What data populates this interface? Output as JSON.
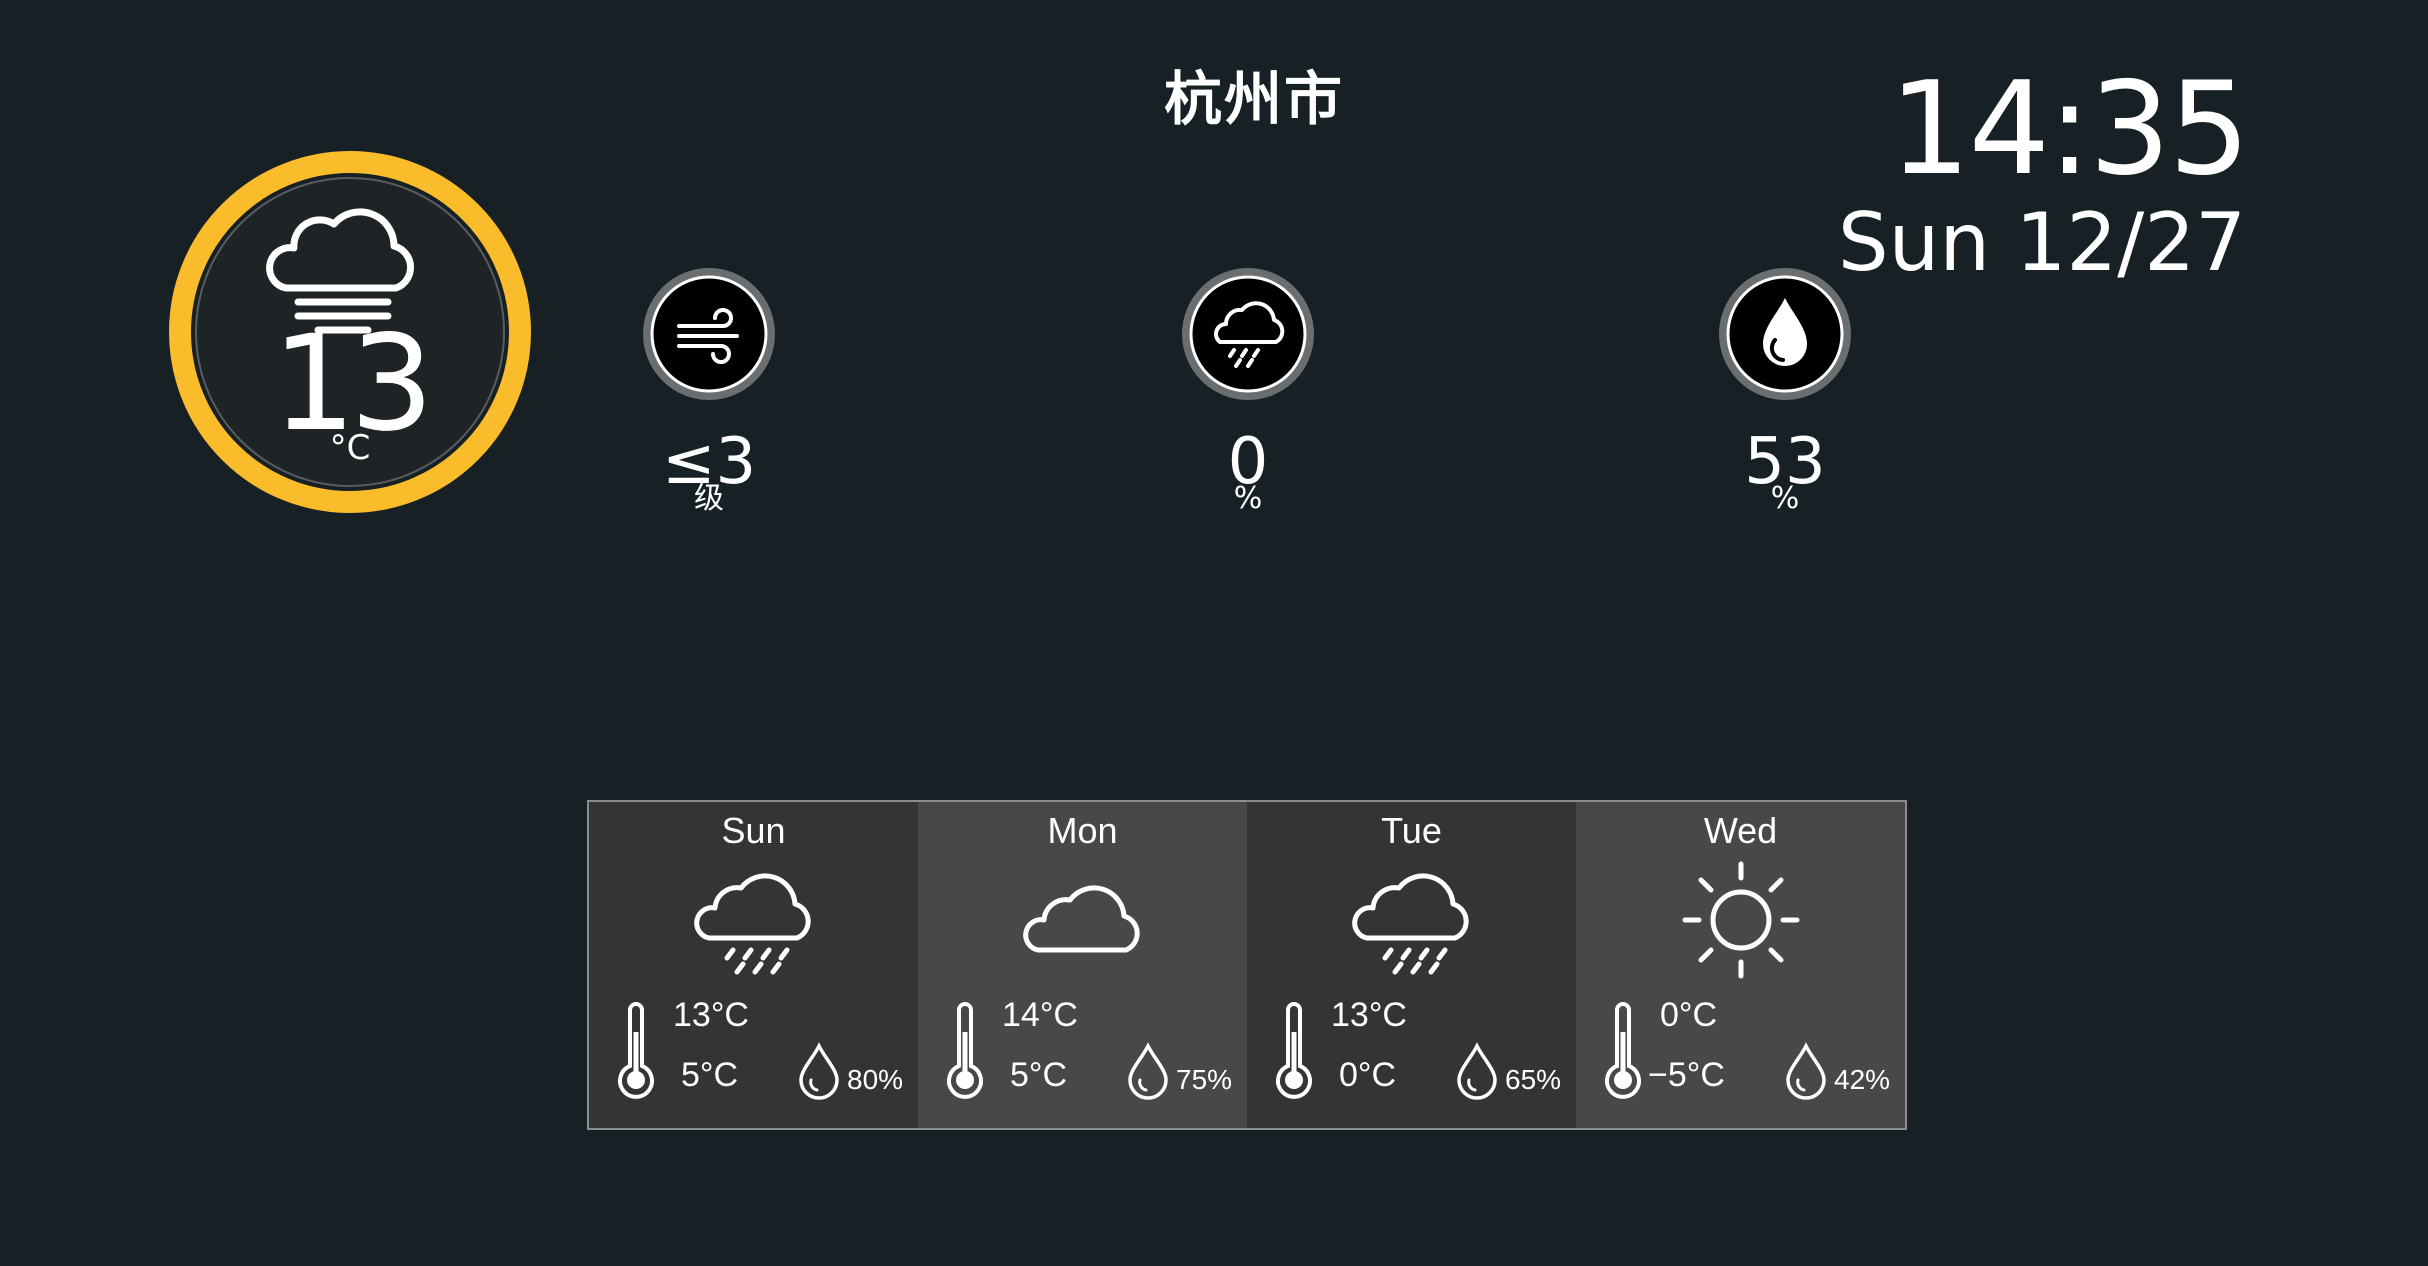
{
  "header": {
    "city": "杭州市",
    "time": "14:35",
    "date": "Sun 12/27"
  },
  "current": {
    "temperature": "13",
    "unit": "°C",
    "condition_icon": "cloud-fog-icon",
    "ring_color": "#fbbc2c"
  },
  "metrics": [
    {
      "icon": "wind-icon",
      "value": "≤3",
      "unit": "级"
    },
    {
      "icon": "cloud-rain-icon",
      "value": "0",
      "unit": "%"
    },
    {
      "icon": "humidity-drop-icon",
      "value": "53",
      "unit": "%"
    }
  ],
  "forecast": [
    {
      "day": "Sun",
      "icon": "cloud-rain-icon",
      "high": "13°C",
      "low": "5°C",
      "humidity": "80%"
    },
    {
      "day": "Mon",
      "icon": "cloud-icon",
      "high": "14°C",
      "low": "5°C",
      "humidity": "75%"
    },
    {
      "day": "Tue",
      "icon": "cloud-rain-icon",
      "high": "13°C",
      "low": "0°C",
      "humidity": "65%"
    },
    {
      "day": "Wed",
      "icon": "sun-icon",
      "high": "0°C",
      "low": "−5°C",
      "humidity": "42%"
    }
  ]
}
